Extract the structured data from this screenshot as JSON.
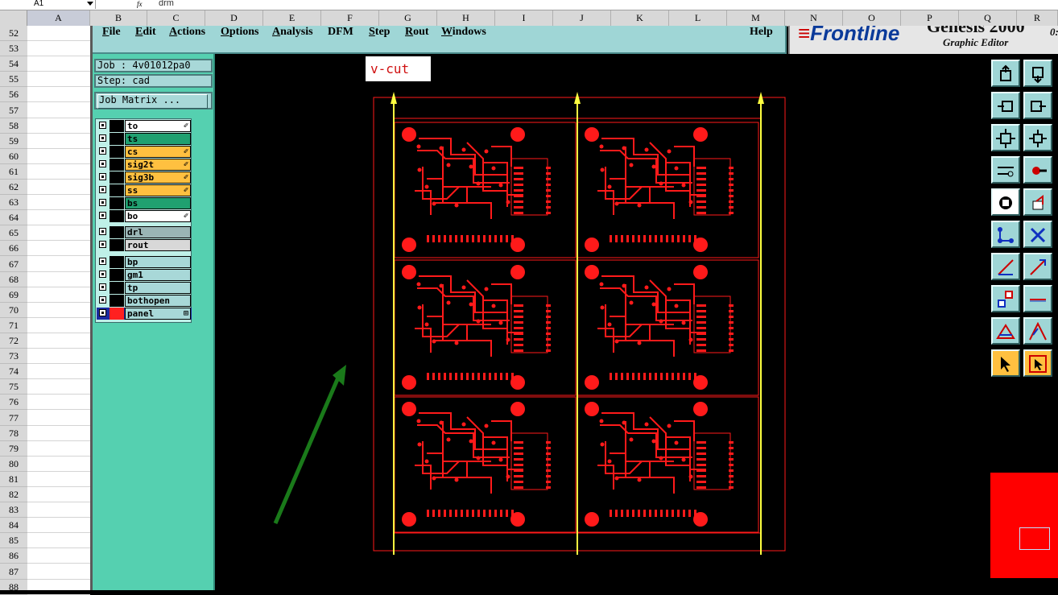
{
  "excel": {
    "name_box": "A1",
    "fx": "fx",
    "formula": "drm",
    "columns": [
      "A",
      "B",
      "C",
      "D",
      "E",
      "F",
      "G",
      "H",
      "I",
      "J",
      "K",
      "L",
      "M",
      "N",
      "O",
      "P",
      "Q",
      "R"
    ],
    "rows": [
      "52",
      "53",
      "54",
      "55",
      "56",
      "57",
      "58",
      "59",
      "60",
      "61",
      "62",
      "63",
      "64",
      "65",
      "66",
      "67",
      "68",
      "69",
      "70",
      "71",
      "72",
      "73",
      "74",
      "75",
      "76",
      "77",
      "78",
      "79",
      "80",
      "81",
      "82",
      "83",
      "84",
      "85",
      "86",
      "87",
      "88"
    ]
  },
  "menu": {
    "items": [
      {
        "label": "File",
        "ul": "F",
        "rest": "ile"
      },
      {
        "label": "Edit",
        "ul": "E",
        "rest": "dit"
      },
      {
        "label": "Actions",
        "ul": "A",
        "rest": "ctions"
      },
      {
        "label": "Options",
        "ul": "O",
        "rest": "ptions"
      },
      {
        "label": "Analysis",
        "ul": "A",
        "rest": "nalysis"
      },
      {
        "label": "DFM",
        "ul": "",
        "rest": "DFM"
      },
      {
        "label": "Step",
        "ul": "S",
        "rest": "tep"
      },
      {
        "label": "Rout",
        "ul": "R",
        "rest": "out"
      },
      {
        "label": "Windows",
        "ul": "W",
        "rest": "indows"
      },
      {
        "label": "Help",
        "ul": "",
        "rest": "Help"
      }
    ]
  },
  "brand": {
    "logo": "Frontline",
    "product": "Genesis 2000",
    "subtitle": "Graphic Editor",
    "version": "0:"
  },
  "job": {
    "job_label": "Job : 4v01012pa0",
    "step_label": "Step: cad",
    "matrix_button": "Job Matrix ..."
  },
  "layers": [
    {
      "name": "to",
      "color": "#ffffff",
      "mark": "✐",
      "group": 1
    },
    {
      "name": "ts",
      "color": "#20a070",
      "mark": "",
      "group": 1
    },
    {
      "name": "cs",
      "color": "#ffc040",
      "mark": "✐",
      "group": 1
    },
    {
      "name": "sig2t",
      "color": "#ffc040",
      "mark": "✐",
      "group": 1
    },
    {
      "name": "sig3b",
      "color": "#ffc040",
      "mark": "✐",
      "group": 1
    },
    {
      "name": "ss",
      "color": "#ffc040",
      "mark": "✐",
      "group": 1
    },
    {
      "name": "bs",
      "color": "#20a070",
      "mark": "",
      "group": 1
    },
    {
      "name": "bo",
      "color": "#ffffff",
      "mark": "✐",
      "group": 1
    },
    {
      "name": "drl",
      "color": "#9ab5b5",
      "mark": "",
      "group": 2
    },
    {
      "name": "rout",
      "color": "#d8d8d8",
      "mark": "",
      "group": 2
    },
    {
      "name": "bp",
      "color": "#a8d8d8",
      "mark": "",
      "group": 3
    },
    {
      "name": "gm1",
      "color": "#a8d8d8",
      "mark": "",
      "group": 3
    },
    {
      "name": "tp",
      "color": "#a8d8d8",
      "mark": "",
      "group": 3
    },
    {
      "name": "bothopen",
      "color": "#a8d8d8",
      "mark": "",
      "group": 3
    },
    {
      "name": "panel",
      "color": "#a8d8d8",
      "mark": "⊞",
      "group": 3,
      "active": true
    }
  ],
  "annotation": {
    "vcut_label": "v-cut",
    "arrow_color": "#1a7a1a",
    "vcut_color": "#ffff40"
  },
  "toolbar": {
    "tools": [
      "move-up-icon",
      "move-down-icon",
      "move-left-icon",
      "move-right-icon",
      "zoom-fit-icon",
      "zoom-home-icon",
      "measure-icon",
      "delete-point-icon",
      "snapshot-icon",
      "layer-select-icon",
      "net-icon",
      "cross-icon",
      "line-icon",
      "line-arrow-icon",
      "pad-icon",
      "flat-line-icon",
      "triangle-icon",
      "angle-icon",
      "pointer-icon",
      "pointer-box-icon"
    ]
  },
  "colors": {
    "pcb": "#ff1a1a",
    "panel_bg": "#55d0b0",
    "menu_bg": "#9fd6d6"
  }
}
